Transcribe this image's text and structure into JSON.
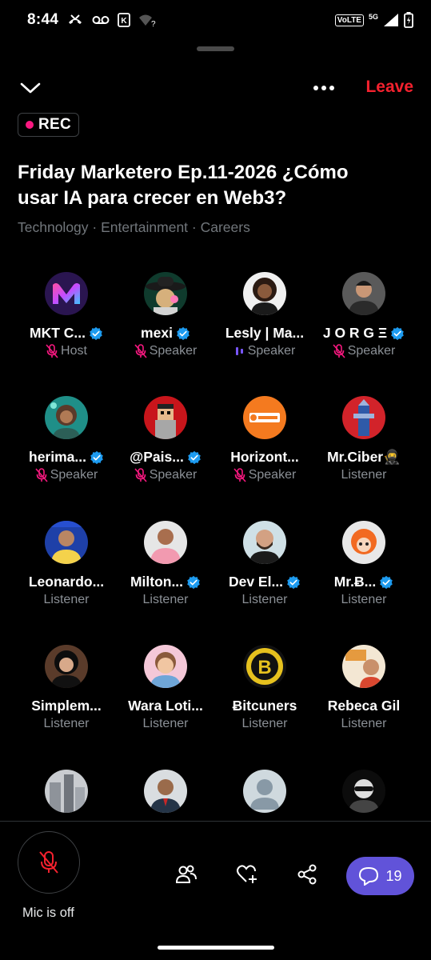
{
  "status_bar": {
    "time": "8:44",
    "network": "VoLTE",
    "signal_label": "5G"
  },
  "header": {
    "leave_label": "Leave",
    "rec_label": "REC",
    "title": "Friday Marketero Ep.11-2026 ¿Cómo usar IA para crecer en Web3?",
    "topics": "Technology · Entertainment · Careers"
  },
  "participants": [
    {
      "name": "MKT C...",
      "role": "Host",
      "verified": true,
      "mic": "muted",
      "avatar": "m-logo"
    },
    {
      "name": "mexi",
      "role": "Speaker",
      "verified": true,
      "mic": "muted",
      "avatar": "sombrero"
    },
    {
      "name": "Lesly | Ma...",
      "role": "Speaker",
      "verified": false,
      "mic": "speaking",
      "avatar": "woman-curly"
    },
    {
      "name": "J O R G Ξ",
      "role": "Speaker",
      "verified": true,
      "mic": "muted",
      "avatar": "man-dark"
    },
    {
      "name": "herima...",
      "role": "Speaker",
      "verified": true,
      "mic": "muted",
      "avatar": "teal-art"
    },
    {
      "name": "@Pais...",
      "role": "Speaker",
      "verified": true,
      "mic": "muted",
      "avatar": "pixel-red"
    },
    {
      "name": "Horizont...",
      "role": "Speaker",
      "verified": false,
      "mic": "muted",
      "avatar": "orange-logo"
    },
    {
      "name": "Mr.Ciber🥷",
      "role": "Listener",
      "verified": false,
      "mic": "none",
      "avatar": "red-tower"
    },
    {
      "name": "Leonardo...",
      "role": "Listener",
      "verified": false,
      "mic": "none",
      "avatar": "blue-man"
    },
    {
      "name": "Milton...",
      "role": "Listener",
      "verified": true,
      "mic": "none",
      "avatar": "man-pink"
    },
    {
      "name": "Dev El...",
      "role": "Listener",
      "verified": true,
      "mic": "none",
      "avatar": "man-beard"
    },
    {
      "name": "Mr.Ƀ...",
      "role": "Listener",
      "verified": true,
      "mic": "none",
      "avatar": "orange-hair"
    },
    {
      "name": "Simplem...",
      "role": "Listener",
      "verified": false,
      "mic": "none",
      "avatar": "woman-dark"
    },
    {
      "name": "Wara Loti...",
      "role": "Listener",
      "verified": false,
      "mic": "none",
      "avatar": "cartoon-boy"
    },
    {
      "name": "Ƀitcuners",
      "role": "Listener",
      "verified": false,
      "mic": "none",
      "avatar": "bitcoin-coin"
    },
    {
      "name": "Rebeca Gil",
      "role": "Listener",
      "verified": false,
      "mic": "none",
      "avatar": "poster-woman"
    },
    {
      "name": "",
      "role": "",
      "verified": false,
      "mic": "none",
      "avatar": "city"
    },
    {
      "name": "",
      "role": "",
      "verified": false,
      "mic": "none",
      "avatar": "man-suit"
    },
    {
      "name": "",
      "role": "",
      "verified": false,
      "mic": "none",
      "avatar": "default-person"
    },
    {
      "name": "",
      "role": "",
      "verified": false,
      "mic": "none",
      "avatar": "sunglasses"
    }
  ],
  "controls": {
    "mic_label": "Mic is off",
    "chat_count": "19"
  },
  "colors": {
    "leave": "#f4212e",
    "rec_dot": "#f91880",
    "verified": "#1d9bf0",
    "muted_icon": "#f91880",
    "speaking": "#7856ff",
    "chat_button": "#6153d9"
  }
}
